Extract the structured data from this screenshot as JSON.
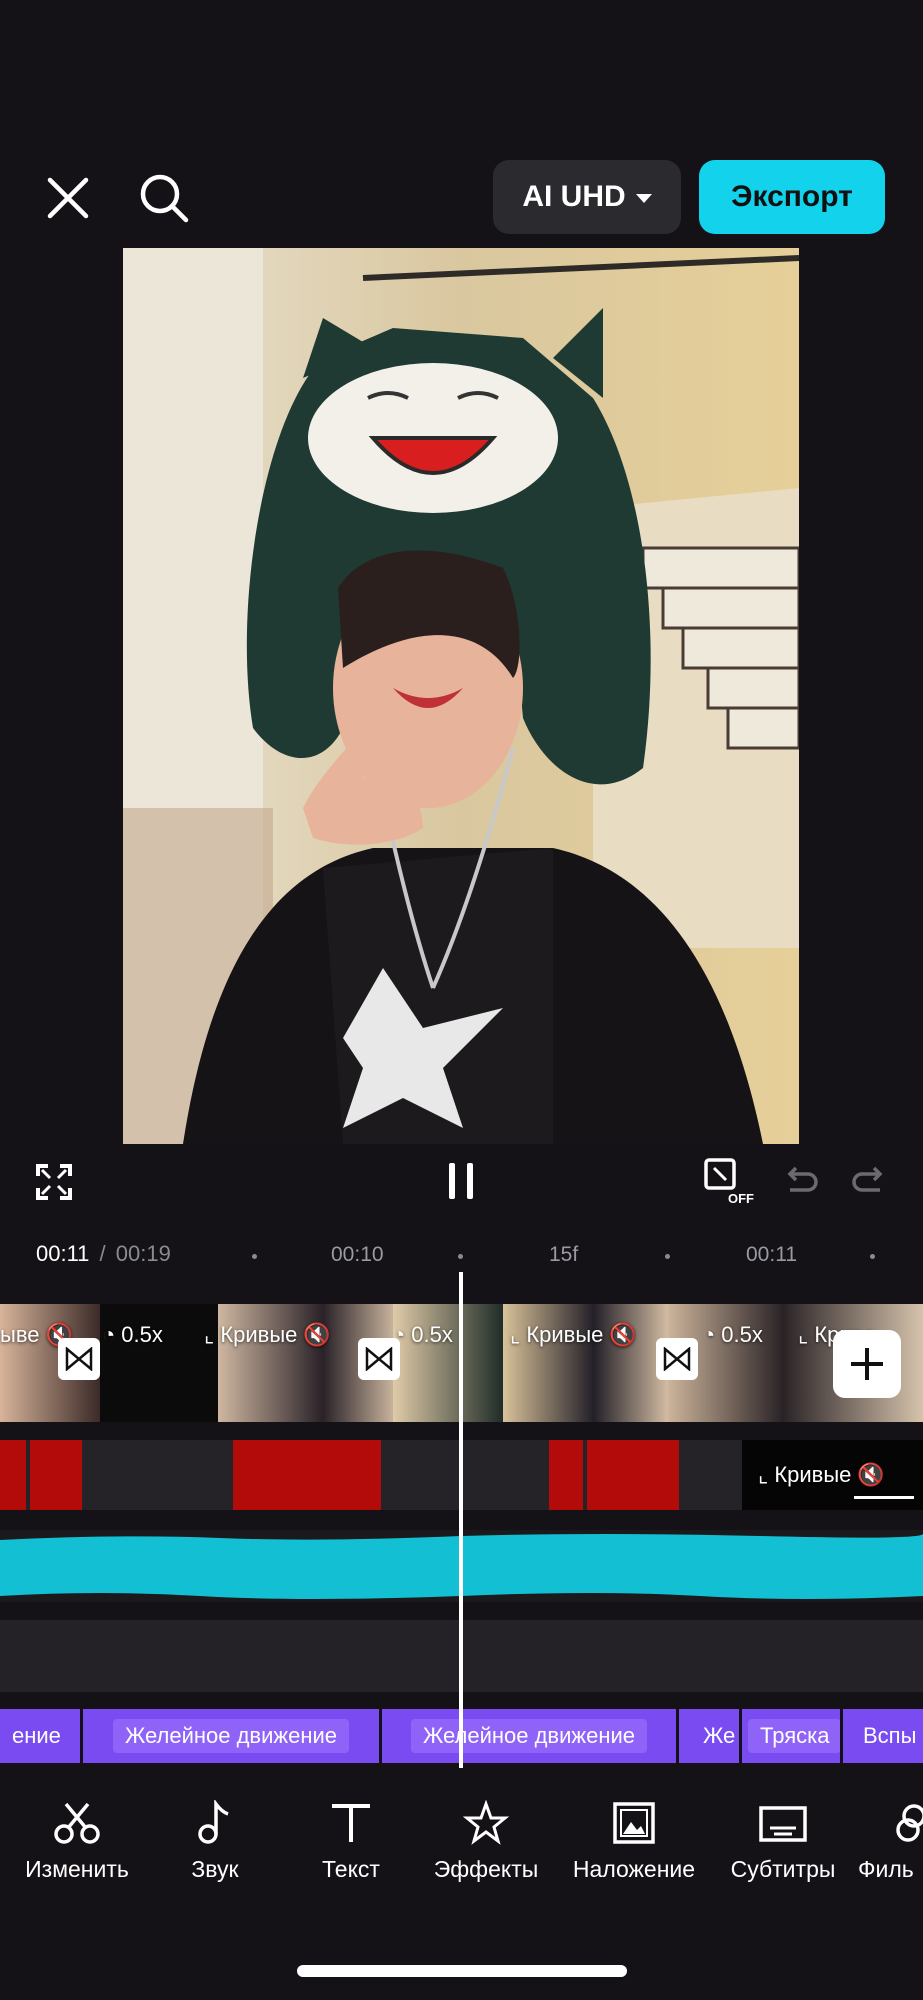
{
  "top_bar": {
    "quality_label": "AI UHD",
    "export_label": "Экспорт"
  },
  "ruler": {
    "current_time": "00:11",
    "separator": "/",
    "total_time": "00:19",
    "marks": [
      "00:10",
      "15f",
      "00:11"
    ]
  },
  "strip": {
    "tags": [
      "ыве",
      "0.5x",
      "Кривые",
      "0.5x",
      "Кривые",
      "0.5x",
      "Криве"
    ],
    "curves_tag": "Кривые"
  },
  "effects": {
    "clips": [
      "ение",
      "Желейное движение",
      "Желейное движение",
      "Же",
      "Тряска",
      "Вспы"
    ]
  },
  "toolbar": {
    "items": [
      "Изменить",
      "Звук",
      "Текст",
      "Эффекты",
      "Наложение",
      "Субтитры",
      "Филь"
    ]
  },
  "colors": {
    "background": "#141216",
    "accent": "#12d2ec",
    "red_track": "#b30a0a",
    "audio_wave": "#13bfd3",
    "effects_track": "#7b4bf2"
  }
}
